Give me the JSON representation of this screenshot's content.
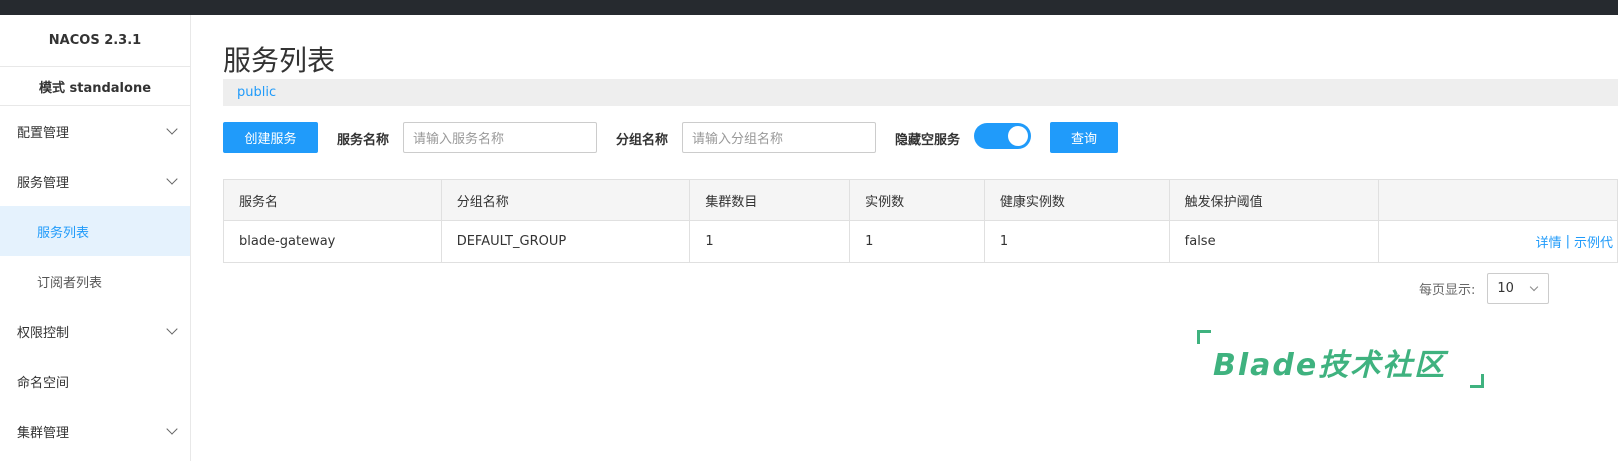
{
  "sidebar": {
    "brand": "NACOS 2.3.1",
    "mode": "模式 standalone",
    "items": [
      {
        "label": "配置管理"
      },
      {
        "label": "服务管理"
      },
      {
        "label": "服务列表"
      },
      {
        "label": "订阅者列表"
      },
      {
        "label": "权限控制"
      },
      {
        "label": "命名空间"
      },
      {
        "label": "集群管理"
      }
    ]
  },
  "main": {
    "title": "服务列表",
    "namespace": "public",
    "toolbar": {
      "create_label": "创建服务",
      "service_name_label": "服务名称",
      "service_name_placeholder": "请输入服务名称",
      "group_name_label": "分组名称",
      "group_name_placeholder": "请输入分组名称",
      "hide_empty_label": "隐藏空服务",
      "hide_empty_on": true,
      "query_label": "查询"
    },
    "table": {
      "headers": [
        "服务名",
        "分组名称",
        "集群数目",
        "实例数",
        "健康实例数",
        "触发保护阈值",
        ""
      ],
      "rows": [
        {
          "service": "blade-gateway",
          "group": "DEFAULT_GROUP",
          "clusters": "1",
          "instances": "1",
          "healthy": "1",
          "threshold": "false",
          "op_detail": "详情",
          "op_sep": "|",
          "op_sample": "示例代"
        }
      ]
    },
    "pager": {
      "label": "每页显示:",
      "page_size": "10"
    }
  },
  "watermark": {
    "text": "Blade技术社区"
  },
  "colors": {
    "accent": "#209bfa",
    "topbar": "#262a2f",
    "watermark": "#3fb27f"
  }
}
